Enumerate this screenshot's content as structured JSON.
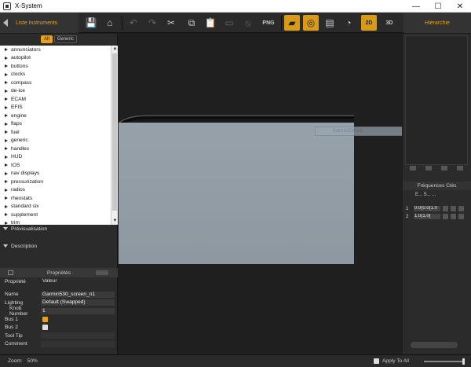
{
  "window": {
    "title": "X-System",
    "controls": [
      "—",
      "☐",
      "✕"
    ]
  },
  "toolbar": {
    "left_tab": "Liste Instruments",
    "right_tab": "Hiérarchie",
    "png_label": "PNG",
    "btn_2d": "2D",
    "btn_3d": "3D"
  },
  "filters": {
    "all": "All",
    "generic": "Generic"
  },
  "instruments": [
    "annunciators",
    "autopilot",
    "buttons",
    "clocks",
    "compass",
    "de-ice",
    "ECAM",
    "EFIS",
    "engine",
    "flaps",
    "fuel",
    "generic",
    "handles",
    "HUD",
    "IOS",
    "nav displays",
    "pressurization",
    "radios",
    "rheostats",
    "standard six",
    "supplement",
    "trim"
  ],
  "sections": {
    "preview": "Prévisualisation",
    "description": "Description"
  },
  "properties": {
    "header": "Propriétés",
    "col_prop": "Propriété",
    "col_val": "Valeur",
    "rows": [
      {
        "key": "Name",
        "value": "Garmin530_screen_n1"
      },
      {
        "key": "Lighting",
        "value": "Default (Swapped)"
      },
      {
        "key": "Knob Number",
        "value": "1"
      },
      {
        "key": "Bus 1",
        "value": ""
      },
      {
        "key": "Bus 2",
        "value": ""
      },
      {
        "key": "Tool Tip",
        "value": ""
      },
      {
        "key": "Comment",
        "value": ""
      }
    ],
    "bus1_checked": true,
    "bus2_checked": false
  },
  "canvas": {
    "ghost_label": "Garmin530 n1"
  },
  "frequencies": {
    "header": "Fréquences Clés",
    "cols": "E...  S... ...",
    "rows": [
      {
        "n": "1",
        "value": "0.0(0.0(1.0"
      },
      {
        "n": "2",
        "value": "1.0(1.0("
      }
    ]
  },
  "status": {
    "zoom_label": "Zoom:",
    "zoom_value": "50%",
    "apply_all": "Apply To All"
  },
  "colors": {
    "accent": "#e8a020",
    "panel": "#2b2b2b",
    "screen": "#959fa8"
  }
}
